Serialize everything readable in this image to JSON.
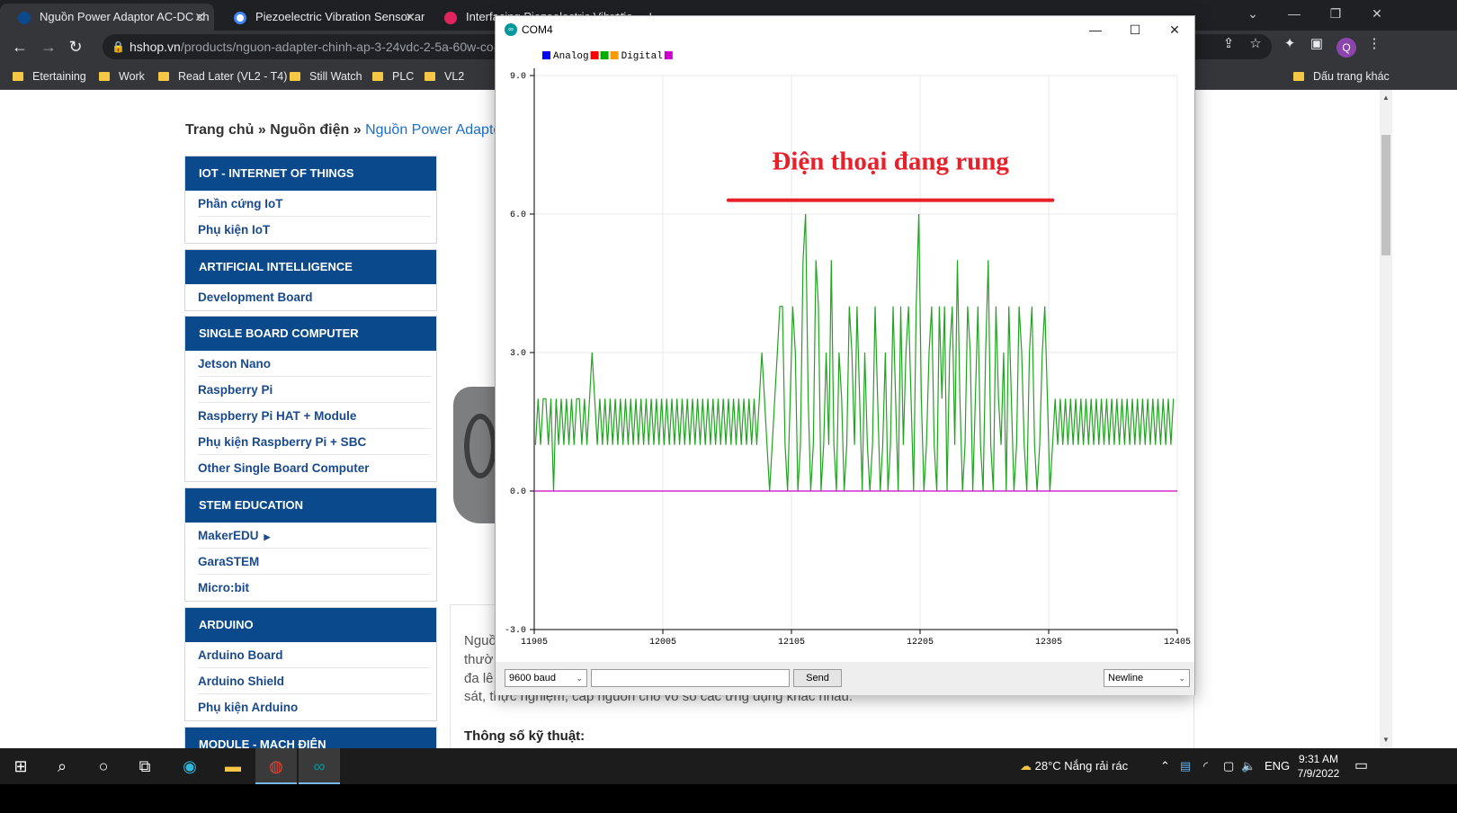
{
  "browser": {
    "tabs": [
      {
        "title": "Nguồn Power Adaptor AC-DC ch"
      },
      {
        "title": "Piezoelectric Vibration Sensor ar"
      },
      {
        "title": "Interfacing Piezoelectric Vibratio"
      }
    ],
    "new_tab": "+",
    "address": {
      "host": "hshop.vn",
      "path": "/products/nguon-adapter-chinh-ap-3-24vdc-2-5a-60w-co-h"
    },
    "profile_initial": "Q",
    "bookmarks": [
      "Etertaining",
      "Work",
      "Read Later (VL2 - T4)",
      "Still Watch",
      "PLC",
      "VL2"
    ],
    "other_bookmarks": "Dấu trang khác"
  },
  "page": {
    "breadcrumb": {
      "home": "Trang chủ",
      "sep": "»",
      "category": "Nguồn điện",
      "current": "Nguồn Power Adaptor"
    },
    "categories": [
      {
        "title": "IOT - INTERNET OF THINGS",
        "items": [
          "Phần cứng IoT",
          "Phụ kiện IoT"
        ]
      },
      {
        "title": "ARTIFICIAL INTELLIGENCE",
        "items": [
          "Development Board"
        ]
      },
      {
        "title": "SINGLE BOARD COMPUTER",
        "items": [
          "Jetson Nano",
          "Raspberry Pi",
          "Raspberry Pi HAT + Module",
          "Phụ kiện Raspberry Pi + SBC",
          "Other Single Board Computer"
        ]
      },
      {
        "title": "STEM EDUCATION",
        "items": [
          "MakerEDU",
          "GaraSTEM",
          "Micro:bit"
        ]
      },
      {
        "title": "ARDUINO",
        "items": [
          "Arduino Board",
          "Arduino Shield",
          "Phụ kiện Arduino"
        ]
      },
      {
        "title": "MODULE - MẠCH ĐIỆN",
        "items": []
      }
    ],
    "description_lines": [
      "Nguồ",
      "thườ",
      "đa lê",
      "sát, thực nghiệm, cấp nguồn cho vô số các ứng dụng khác nhau."
    ],
    "spec_heading": "Thông số kỹ thuật:"
  },
  "plotter": {
    "window_title": "COM4",
    "legend": [
      {
        "label": "Analog",
        "color": "#0000ff"
      },
      {
        "label": "",
        "color": "#ff0000"
      },
      {
        "label": "",
        "color": "#00aa00"
      },
      {
        "label": "Digital",
        "color": "#ff9900"
      },
      {
        "label": "",
        "color": "#cc00cc"
      }
    ],
    "annotation": "Điện thoại đang rung",
    "annotation_color": "#e8202a",
    "baud": "9600 baud",
    "send_label": "Send",
    "line_ending": "Newline"
  },
  "chart_data": {
    "type": "line",
    "title": "",
    "xlabel": "",
    "ylabel": "",
    "xlim": [
      11905,
      12405
    ],
    "ylim": [
      -3.0,
      9.0
    ],
    "x_ticks": [
      "11905",
      "12005",
      "12105",
      "12205",
      "12305",
      "12405"
    ],
    "y_ticks": [
      "9.0",
      "6.0",
      "3.0",
      "0.0",
      "-3.0"
    ],
    "grid": true,
    "legend_position": "top-left",
    "annotations": [
      {
        "text": "Điện thoại đang rung",
        "x_range": [
          12056,
          12308
        ],
        "y": 6.3
      }
    ],
    "series": [
      {
        "name": "",
        "color": "#22a322",
        "points": [
          [
            11906,
            1
          ],
          [
            11908,
            2
          ],
          [
            11910,
            1
          ],
          [
            11912,
            2
          ],
          [
            11914,
            2
          ],
          [
            11916,
            1
          ],
          [
            11918,
            2
          ],
          [
            11920,
            0
          ],
          [
            11922,
            2
          ],
          [
            11924,
            1
          ],
          [
            11926,
            2
          ],
          [
            11928,
            1
          ],
          [
            11930,
            2
          ],
          [
            11932,
            1
          ],
          [
            11934,
            2
          ],
          [
            11936,
            1
          ],
          [
            11938,
            2
          ],
          [
            11940,
            2
          ],
          [
            11942,
            1
          ],
          [
            11944,
            2
          ],
          [
            11946,
            1
          ],
          [
            11948,
            2
          ],
          [
            11950,
            3
          ],
          [
            11952,
            2
          ],
          [
            11954,
            1
          ],
          [
            11956,
            2
          ],
          [
            11958,
            1
          ],
          [
            11960,
            2
          ],
          [
            11962,
            1
          ],
          [
            11964,
            2
          ],
          [
            11966,
            1
          ],
          [
            11968,
            2
          ],
          [
            11970,
            1
          ],
          [
            11972,
            2
          ],
          [
            11974,
            1
          ],
          [
            11976,
            2
          ],
          [
            11978,
            1
          ],
          [
            11980,
            2
          ],
          [
            11982,
            1
          ],
          [
            11984,
            2
          ],
          [
            11986,
            1
          ],
          [
            11988,
            2
          ],
          [
            11990,
            1
          ],
          [
            11992,
            2
          ],
          [
            11994,
            1
          ],
          [
            11996,
            2
          ],
          [
            11998,
            1
          ],
          [
            12000,
            2
          ],
          [
            12002,
            1
          ],
          [
            12004,
            2
          ],
          [
            12006,
            1
          ],
          [
            12008,
            2
          ],
          [
            12010,
            1
          ],
          [
            12012,
            2
          ],
          [
            12014,
            1
          ],
          [
            12016,
            2
          ],
          [
            12018,
            1
          ],
          [
            12020,
            2
          ],
          [
            12022,
            1
          ],
          [
            12024,
            2
          ],
          [
            12026,
            1
          ],
          [
            12028,
            2
          ],
          [
            12030,
            1
          ],
          [
            12032,
            2
          ],
          [
            12034,
            1
          ],
          [
            12036,
            2
          ],
          [
            12038,
            1
          ],
          [
            12040,
            2
          ],
          [
            12042,
            1
          ],
          [
            12044,
            2
          ],
          [
            12046,
            1
          ],
          [
            12048,
            2
          ],
          [
            12050,
            1
          ],
          [
            12052,
            2
          ],
          [
            12054,
            1
          ],
          [
            12056,
            2
          ],
          [
            12058,
            1
          ],
          [
            12060,
            2
          ],
          [
            12062,
            1
          ],
          [
            12064,
            2
          ],
          [
            12066,
            1
          ],
          [
            12068,
            2
          ],
          [
            12070,
            1
          ],
          [
            12072,
            2
          ],
          [
            12074,
            1
          ],
          [
            12076,
            2
          ],
          [
            12078,
            1
          ],
          [
            12080,
            2
          ],
          [
            12082,
            3
          ],
          [
            12084,
            2
          ],
          [
            12086,
            1
          ],
          [
            12088,
            0
          ],
          [
            12090,
            1
          ],
          [
            12092,
            2
          ],
          [
            12094,
            3
          ],
          [
            12096,
            4
          ],
          [
            12098,
            4
          ],
          [
            12100,
            1
          ],
          [
            12102,
            0
          ],
          [
            12104,
            2
          ],
          [
            12106,
            4
          ],
          [
            12108,
            3
          ],
          [
            12110,
            0
          ],
          [
            12112,
            1
          ],
          [
            12114,
            5
          ],
          [
            12116,
            6
          ],
          [
            12118,
            2
          ],
          [
            12120,
            0
          ],
          [
            12122,
            1
          ],
          [
            12124,
            5
          ],
          [
            12126,
            4
          ],
          [
            12128,
            0
          ],
          [
            12130,
            1
          ],
          [
            12132,
            3
          ],
          [
            12134,
            1
          ],
          [
            12136,
            5
          ],
          [
            12138,
            1
          ],
          [
            12140,
            0
          ],
          [
            12142,
            3
          ],
          [
            12144,
            2
          ],
          [
            12146,
            0
          ],
          [
            12148,
            1
          ],
          [
            12150,
            4
          ],
          [
            12152,
            3
          ],
          [
            12154,
            1
          ],
          [
            12156,
            4
          ],
          [
            12158,
            2
          ],
          [
            12160,
            0
          ],
          [
            12162,
            3
          ],
          [
            12164,
            1
          ],
          [
            12166,
            0
          ],
          [
            12168,
            1
          ],
          [
            12170,
            4
          ],
          [
            12172,
            2
          ],
          [
            12174,
            0
          ],
          [
            12176,
            1
          ],
          [
            12178,
            3
          ],
          [
            12180,
            0
          ],
          [
            12182,
            1
          ],
          [
            12184,
            4
          ],
          [
            12186,
            2
          ],
          [
            12188,
            0
          ],
          [
            12190,
            4
          ],
          [
            12192,
            1
          ],
          [
            12194,
            3
          ],
          [
            12196,
            4
          ],
          [
            12198,
            2
          ],
          [
            12200,
            0
          ],
          [
            12202,
            4
          ],
          [
            12204,
            6
          ],
          [
            12206,
            2
          ],
          [
            12208,
            0
          ],
          [
            12210,
            1
          ],
          [
            12212,
            3
          ],
          [
            12214,
            4
          ],
          [
            12216,
            1
          ],
          [
            12218,
            0
          ],
          [
            12220,
            4
          ],
          [
            12222,
            2
          ],
          [
            12224,
            4
          ],
          [
            12226,
            0
          ],
          [
            12228,
            3
          ],
          [
            12230,
            4
          ],
          [
            12232,
            1
          ],
          [
            12234,
            5
          ],
          [
            12236,
            2
          ],
          [
            12238,
            0
          ],
          [
            12240,
            1
          ],
          [
            12242,
            4
          ],
          [
            12244,
            3
          ],
          [
            12246,
            0
          ],
          [
            12248,
            2
          ],
          [
            12250,
            4
          ],
          [
            12252,
            1
          ],
          [
            12254,
            0
          ],
          [
            12256,
            3
          ],
          [
            12258,
            5
          ],
          [
            12260,
            1
          ],
          [
            12262,
            0
          ],
          [
            12264,
            4
          ],
          [
            12266,
            2
          ],
          [
            12268,
            1
          ],
          [
            12270,
            3
          ],
          [
            12272,
            0
          ],
          [
            12274,
            4
          ],
          [
            12276,
            2
          ],
          [
            12278,
            0
          ],
          [
            12280,
            1
          ],
          [
            12282,
            4
          ],
          [
            12284,
            3
          ],
          [
            12286,
            1
          ],
          [
            12288,
            0
          ],
          [
            12290,
            3
          ],
          [
            12292,
            4
          ],
          [
            12294,
            1
          ],
          [
            12296,
            0
          ],
          [
            12298,
            1
          ],
          [
            12300,
            3
          ],
          [
            12302,
            4
          ],
          [
            12304,
            2
          ],
          [
            12306,
            0
          ],
          [
            12308,
            1
          ],
          [
            12310,
            2
          ],
          [
            12312,
            1
          ],
          [
            12314,
            2
          ],
          [
            12316,
            1
          ],
          [
            12318,
            2
          ],
          [
            12320,
            1
          ],
          [
            12322,
            2
          ],
          [
            12324,
            1
          ],
          [
            12326,
            2
          ],
          [
            12328,
            1
          ],
          [
            12330,
            2
          ],
          [
            12332,
            1
          ],
          [
            12334,
            2
          ],
          [
            12336,
            1
          ],
          [
            12338,
            2
          ],
          [
            12340,
            1
          ],
          [
            12342,
            2
          ],
          [
            12344,
            1
          ],
          [
            12346,
            2
          ],
          [
            12348,
            1
          ],
          [
            12350,
            2
          ],
          [
            12352,
            1
          ],
          [
            12354,
            2
          ],
          [
            12356,
            1
          ],
          [
            12358,
            2
          ],
          [
            12360,
            1
          ],
          [
            12362,
            2
          ],
          [
            12364,
            1
          ],
          [
            12366,
            2
          ],
          [
            12368,
            1
          ],
          [
            12370,
            2
          ],
          [
            12372,
            1
          ],
          [
            12374,
            2
          ],
          [
            12376,
            1
          ],
          [
            12378,
            2
          ],
          [
            12380,
            1
          ],
          [
            12382,
            2
          ],
          [
            12384,
            1
          ],
          [
            12386,
            2
          ],
          [
            12388,
            1
          ],
          [
            12390,
            2
          ],
          [
            12392,
            1
          ],
          [
            12394,
            2
          ],
          [
            12396,
            1
          ],
          [
            12398,
            2
          ],
          [
            12400,
            1
          ],
          [
            12402,
            2
          ]
        ]
      },
      {
        "name": "",
        "color": "#cc00cc",
        "points": [
          [
            11905,
            0
          ],
          [
            12405,
            0
          ]
        ]
      }
    ]
  },
  "taskbar": {
    "weather": "28°C  Nắng rải rác",
    "lang": "ENG",
    "time": "9:31 AM",
    "date": "7/9/2022"
  }
}
